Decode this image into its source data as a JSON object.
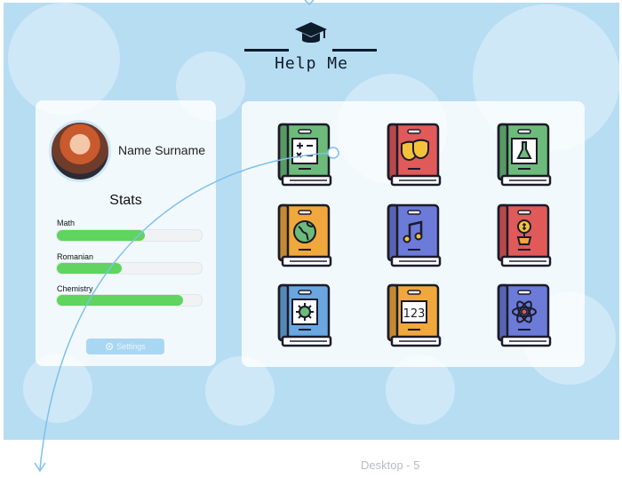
{
  "header": {
    "title": "Help Me",
    "icon": "graduation-cap-icon"
  },
  "profile": {
    "name": "Name Surname"
  },
  "stats": {
    "title": "Stats",
    "items": [
      {
        "label": "Math",
        "progress": 0.61
      },
      {
        "label": "Romanian",
        "progress": 0.45
      },
      {
        "label": "Chemistry",
        "progress": 0.87
      }
    ]
  },
  "settings": {
    "label": "Settings",
    "icon": "gear-icon"
  },
  "books": [
    {
      "subject": "math",
      "icon": "math-book-icon",
      "color": "#6dbb7a"
    },
    {
      "subject": "theatre",
      "icon": "theatre-masks-book-icon",
      "color": "#e05a5a"
    },
    {
      "subject": "chemistry",
      "icon": "flask-book-icon",
      "color": "#6dbb7a"
    },
    {
      "subject": "geography",
      "icon": "globe-book-icon",
      "color": "#f0a83c"
    },
    {
      "subject": "music",
      "icon": "music-note-book-icon",
      "color": "#6c7bd8"
    },
    {
      "subject": "economics",
      "icon": "money-plant-book-icon",
      "color": "#e05a5a"
    },
    {
      "subject": "biology",
      "icon": "virus-book-icon",
      "color": "#6aa7e0"
    },
    {
      "subject": "numbers",
      "icon": "numbers-123-book-icon",
      "color": "#f0a83c"
    },
    {
      "subject": "physics",
      "icon": "atom-book-icon",
      "color": "#6c7bd8"
    }
  ],
  "footer": {
    "label": "Desktop - 5"
  }
}
